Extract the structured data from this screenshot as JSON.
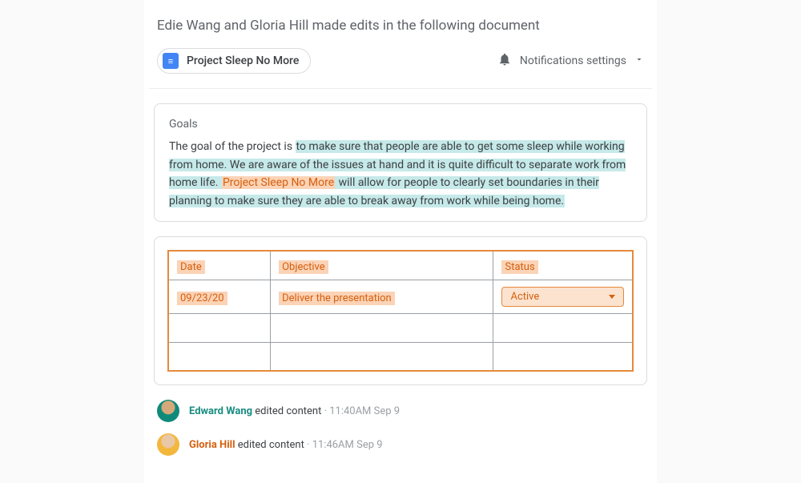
{
  "header": {
    "title": "Edie Wang and Gloria Hill made edits in the following document",
    "doc_label": "Project Sleep No More",
    "notifications_label": "Notifications settings"
  },
  "goals": {
    "heading": "Goals",
    "prefix": "The goal of the project is ",
    "hl1": "to make sure that people are able to get some sleep while working from home. We are aware of the issues at hand and it is quite difficult to separate work from home life. ",
    "hl_orange": "Project Sleep No More",
    "hl2": " will allow for people to clearly set boundaries in their planning to make sure they are able to break away from work while being home."
  },
  "table": {
    "headers": {
      "date": "Date",
      "objective": "Objective",
      "status": "Status"
    },
    "row1": {
      "date": "09/23/20",
      "objective": "Deliver the presentation",
      "status": "Active"
    }
  },
  "feed": {
    "item1": {
      "user": "Edward Wang",
      "action": " edited content",
      "sep": " · ",
      "time": "11:40AM Sep 9"
    },
    "item2": {
      "user": "Gloria Hill",
      "action": " edited content",
      "sep": " · ",
      "time": "11:46AM Sep 9"
    }
  }
}
